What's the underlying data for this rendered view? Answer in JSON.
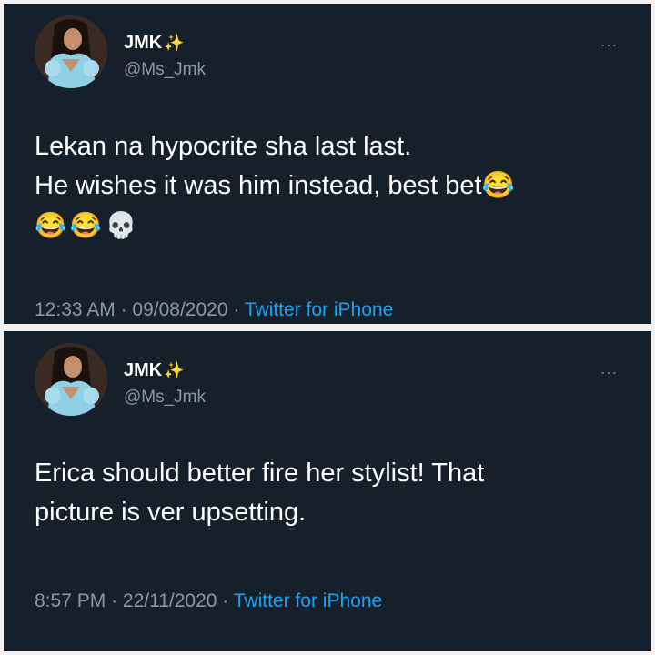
{
  "tweets": [
    {
      "display_name": "JMK",
      "name_emoji": "✨",
      "handle": "@Ms_Jmk",
      "more_icon": "…",
      "lines": [
        "Lekan na hypocrite sha last last.",
        "He wishes it was him instead, best bet😂"
      ],
      "emoji_line": "😂😂💀",
      "time": "12:33 AM",
      "separator": "·",
      "date": "09/08/2020",
      "source": "Twitter for iPhone"
    },
    {
      "display_name": "JMK",
      "name_emoji": "✨",
      "handle": "@Ms_Jmk",
      "more_icon": "…",
      "lines": [
        "Erica should better fire her stylist! That",
        "picture is ver upsetting."
      ],
      "time": "8:57 PM",
      "separator": "·",
      "date": "22/11/2020",
      "source": "Twitter for iPhone"
    }
  ],
  "colors": {
    "background": "#15202b",
    "text": "#ffffff",
    "secondary": "#8b98a5",
    "link": "#1da1f2",
    "sparkle": "#f5c518"
  }
}
